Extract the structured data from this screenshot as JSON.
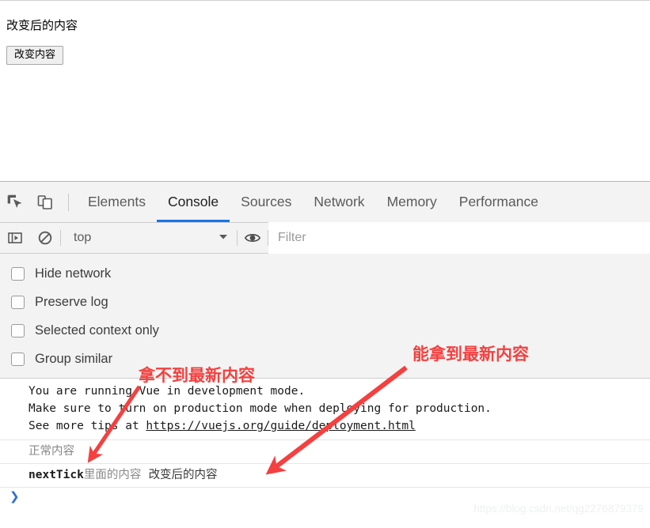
{
  "page": {
    "heading": "改变后的内容",
    "button_label": "改变内容"
  },
  "devtools": {
    "toolbar_icons": [
      {
        "name": "inspect-element-icon",
        "label": "Inspect element"
      },
      {
        "name": "toggle-device-toolbar-icon",
        "label": "Toggle device toolbar"
      }
    ],
    "tabs": [
      {
        "label": "Elements",
        "active": false
      },
      {
        "label": "Console",
        "active": true
      },
      {
        "label": "Sources",
        "active": false
      },
      {
        "label": "Network",
        "active": false
      },
      {
        "label": "Memory",
        "active": false
      },
      {
        "label": "Performance",
        "active": false
      }
    ],
    "active_tab": "Console",
    "accent_color": "#1a73e8"
  },
  "filter_bar": {
    "sidebar_toggle_icon": "console-sidebar-icon",
    "clear_console_icon": "clear-console-icon",
    "context_label": "top",
    "context_dropdown_icon": "chevron-down-icon",
    "live_expression_icon": "eye-icon",
    "filter_placeholder": "Filter",
    "filter_value": ""
  },
  "console_settings": {
    "options": [
      {
        "label": "Hide network",
        "checked": false
      },
      {
        "label": "Preserve log",
        "checked": false
      },
      {
        "label": "Selected context only",
        "checked": false
      },
      {
        "label": "Group similar",
        "checked": false
      }
    ]
  },
  "console_messages": {
    "vue_warning": {
      "line1": "You are running Vue in development mode.",
      "line2": "Make sure to turn on production mode when deploying for production.",
      "line3_prefix": "See more tips at ",
      "line3_link": "https://vuejs.org/guide/deployment.html"
    },
    "log_normal": "正常内容",
    "log_nexttick_mono": "nextTick",
    "log_nexttick_cjk": "里面的内容",
    "log_nexttick_value": "改变后的内容",
    "prompt_caret": "❯"
  },
  "annotations": {
    "left_text": "拿不到最新内容",
    "right_text": "能拿到最新内容",
    "color": "#f5403f"
  },
  "watermark": {
    "text": "https://blog.csdn.net/qg2276879379"
  }
}
